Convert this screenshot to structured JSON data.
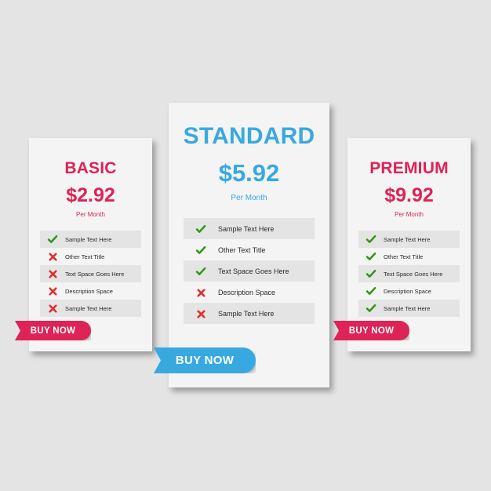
{
  "page": {
    "background_color": "#e4e4e4",
    "card_background_color": "#f4f4f4",
    "row_shade_color": "#e4e4e4",
    "accent_pink": "#de2356",
    "accent_blue": "#38a9e0",
    "check_color": "#2e9414",
    "cross_color": "#e02b2b"
  },
  "plans": [
    {
      "id": "basic",
      "name": "BASIC",
      "price": "$2.92",
      "period": "Per Month",
      "accent": "#de2356",
      "cta_label": "BUY NOW",
      "features": [
        {
          "label": "Sample Text Here",
          "icon": "check-icon",
          "included": true,
          "shaded": true
        },
        {
          "label": "Other Text Title",
          "icon": "cross-icon",
          "included": false,
          "shaded": false
        },
        {
          "label": "Text Space Goes Here",
          "icon": "cross-icon",
          "included": false,
          "shaded": true
        },
        {
          "label": "Description Space",
          "icon": "cross-icon",
          "included": false,
          "shaded": false
        },
        {
          "label": "Sample Text Here",
          "icon": "cross-icon",
          "included": false,
          "shaded": true
        }
      ]
    },
    {
      "id": "standard",
      "name": "STANDARD",
      "price": "$5.92",
      "period": "Per Month",
      "accent": "#38a9e0",
      "cta_label": "BUY NOW",
      "features": [
        {
          "label": "Sample Text Here",
          "icon": "check-icon",
          "included": true,
          "shaded": true
        },
        {
          "label": "Other Text Title",
          "icon": "check-icon",
          "included": true,
          "shaded": false
        },
        {
          "label": "Text Space Goes Here",
          "icon": "check-icon",
          "included": true,
          "shaded": true
        },
        {
          "label": "Description Space",
          "icon": "cross-icon",
          "included": false,
          "shaded": false
        },
        {
          "label": "Sample Text Here",
          "icon": "cross-icon",
          "included": false,
          "shaded": true
        }
      ]
    },
    {
      "id": "premium",
      "name": "PREMIUM",
      "price": "$9.92",
      "period": "Per Month",
      "accent": "#de2356",
      "cta_label": "BUY NOW",
      "features": [
        {
          "label": "Sample Text Here",
          "icon": "check-icon",
          "included": true,
          "shaded": true
        },
        {
          "label": "Other Text Title",
          "icon": "check-icon",
          "included": true,
          "shaded": false
        },
        {
          "label": "Text Space Goes Here",
          "icon": "check-icon",
          "included": true,
          "shaded": true
        },
        {
          "label": "Description Space",
          "icon": "check-icon",
          "included": true,
          "shaded": false
        },
        {
          "label": "Sample Text Here",
          "icon": "check-icon",
          "included": true,
          "shaded": true
        }
      ]
    }
  ]
}
